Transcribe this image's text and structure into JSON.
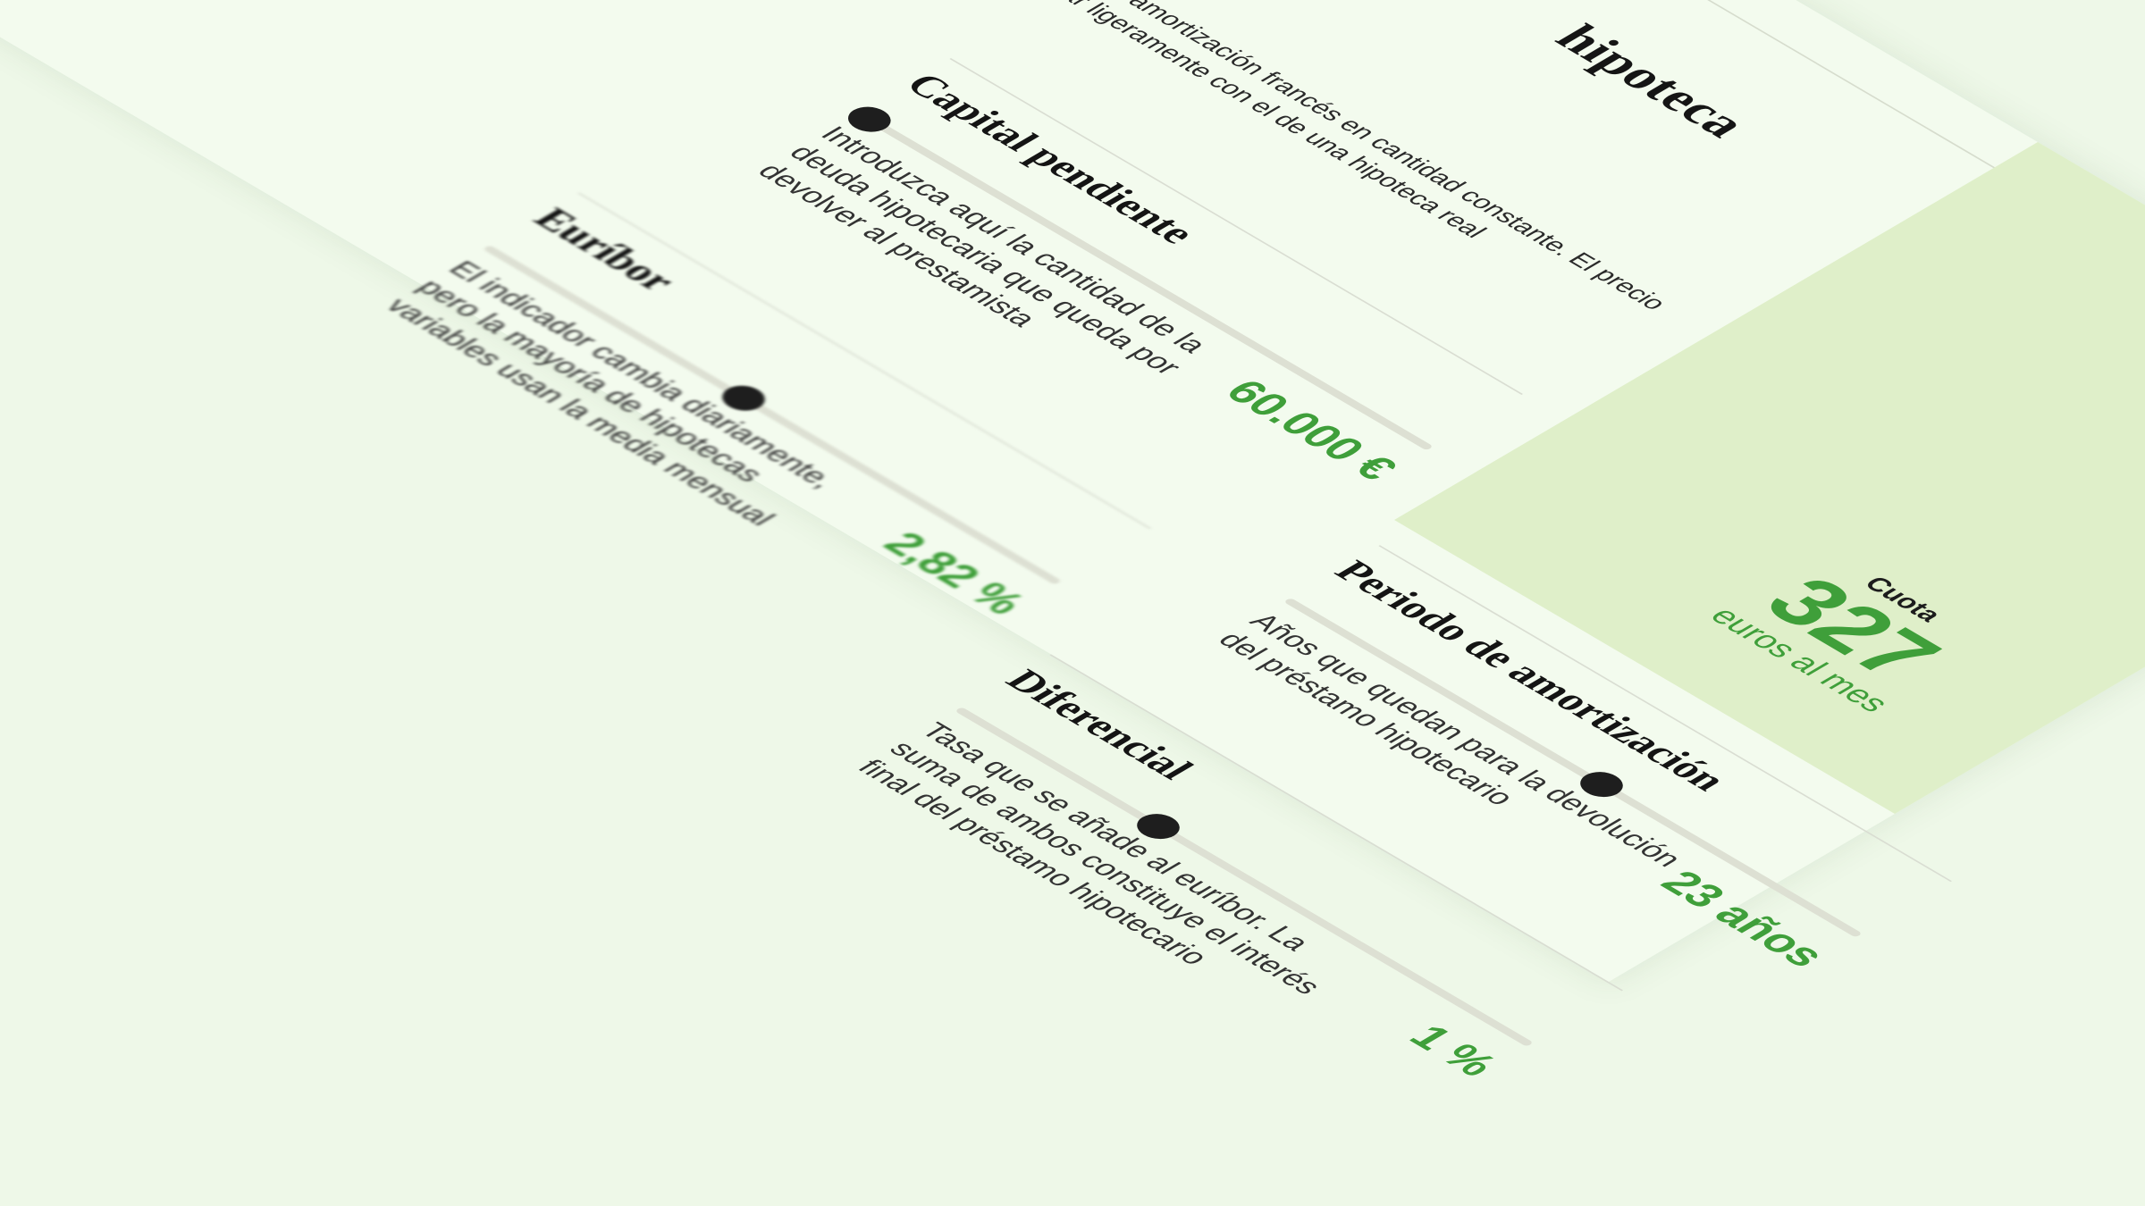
{
  "calculator": {
    "title": "hipoteca",
    "description": "Calculada con el sistema de amortización francés en cantidad constante. El precio reflejado aquí puede variar ligeramente con el de una hipoteca real",
    "result": {
      "label": "Cuota",
      "value": "327",
      "unit": "euros al mes"
    },
    "fields": [
      {
        "label": "Capital pendiente",
        "help": "Introduzca aquí la cantidad de la deuda hipotecaria que queda por devolver al prestamista",
        "value": "60.000 €",
        "slider_level": 0.02
      },
      {
        "label": "Periodo de amortización",
        "help": "Años que quedan para la devolución del préstamo hipotecario",
        "value": "23 años",
        "slider_level": 0.55
      },
      {
        "label": "Euríbor",
        "help": "El indicador cambia diariamente, pero la mayoría de hipotecas variables usan la media mensual",
        "value": "2,82 %",
        "slider_level": 0.45
      },
      {
        "label": "Diferencial",
        "help": "Tasa que se añade al euríbor. La suma de ambos constituye el interés final del préstamo hipotecario",
        "value": "1 %",
        "slider_level": 0.35
      }
    ],
    "colors": {
      "page_background": "#eef8e8",
      "card_background": "#f3fbee",
      "result_panel": "#dfefc9",
      "accent_green": "#3f9f3a",
      "slider_track": "#dde0d3",
      "slider_thumb": "#1e1e1e"
    }
  }
}
